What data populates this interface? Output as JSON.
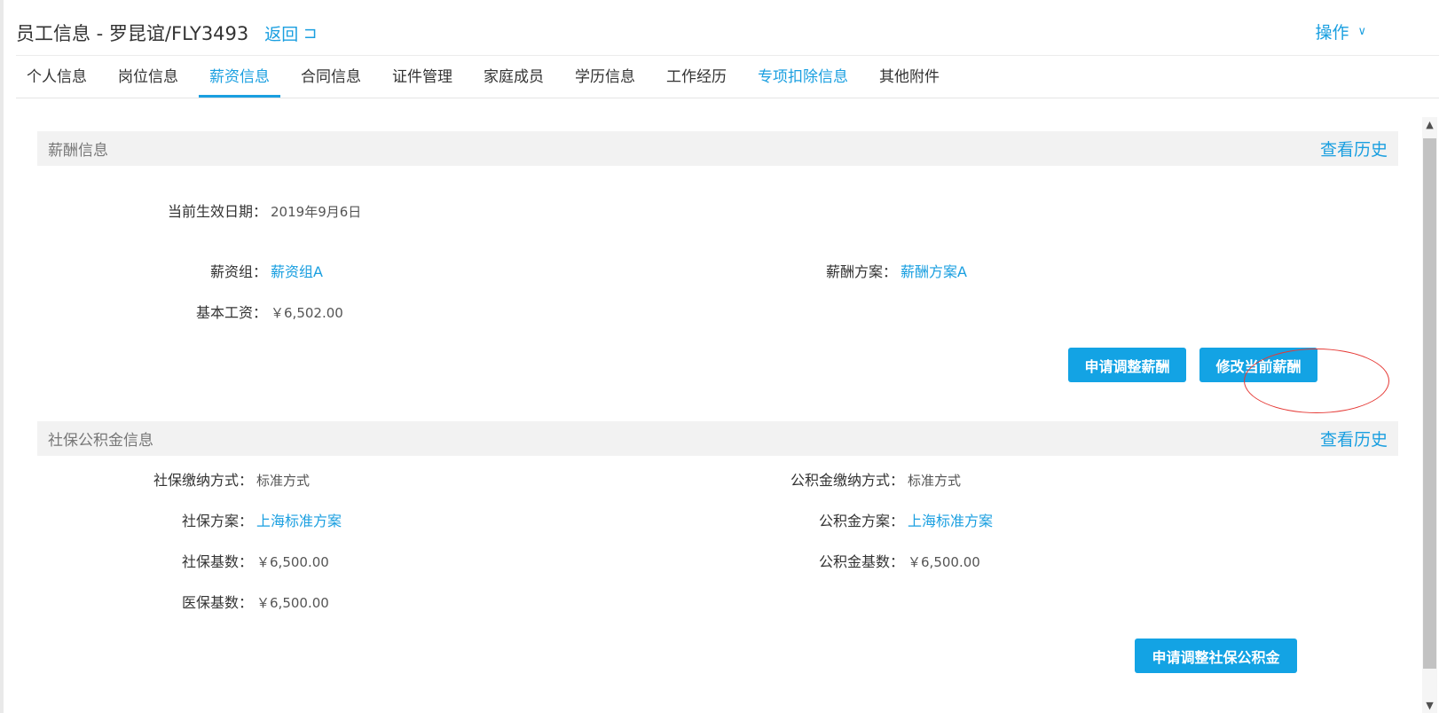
{
  "header": {
    "title": "员工信息 - 罗昆谊/FLY3493",
    "back_label": "返回",
    "back_icon": "↩-icon",
    "ops_label": "操作",
    "ops_icon": "chevron-down-icon"
  },
  "tabs": [
    {
      "label": "个人信息"
    },
    {
      "label": "岗位信息"
    },
    {
      "label": "薪资信息"
    },
    {
      "label": "合同信息"
    },
    {
      "label": "证件管理"
    },
    {
      "label": "家庭成员"
    },
    {
      "label": "学历信息"
    },
    {
      "label": "工作经历"
    },
    {
      "label": "专项扣除信息"
    },
    {
      "label": "其他附件"
    }
  ],
  "active_tab": "薪资信息",
  "salary": {
    "section_title": "薪酬信息",
    "history_label": "查看历史",
    "effective_date_label": "当前生效日期：",
    "effective_date_value": "2019年9月6日",
    "group_label": "薪资组：",
    "group_value": "薪资组A",
    "plan_label": "薪酬方案：",
    "plan_value": "薪酬方案A",
    "base_label": "基本工资：",
    "base_value": "￥6,502.00",
    "apply_adjust_button": "申请调整薪酬",
    "modify_current_button": "修改当前薪酬"
  },
  "social": {
    "section_title": "社保公积金信息",
    "history_label": "查看历史",
    "ss_method_label": "社保缴纳方式：",
    "ss_method_value": "标准方式",
    "hf_method_label": "公积金缴纳方式：",
    "hf_method_value": "标准方式",
    "ss_plan_label": "社保方案：",
    "ss_plan_value": "上海标准方案",
    "hf_plan_label": "公积金方案：",
    "hf_plan_value": "上海标准方案",
    "ss_base_label": "社保基数：",
    "ss_base_value": "￥6,500.00",
    "hf_base_label": "公积金基数：",
    "hf_base_value": "￥6,500.00",
    "med_base_label": "医保基数：",
    "med_base_value": "￥6,500.00",
    "apply_adjust_button": "申请调整社保公积金"
  },
  "colors": {
    "accent": "#1a9fe0",
    "button": "#13a3e4",
    "annotation_circle": "#e53935"
  }
}
